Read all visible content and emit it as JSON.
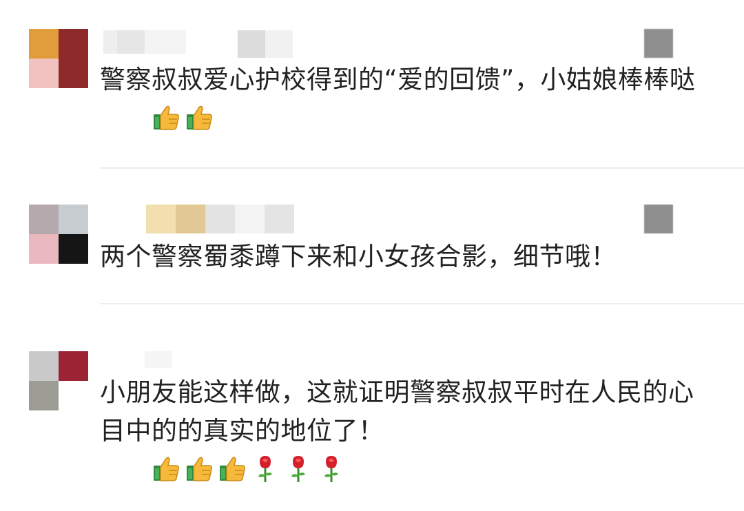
{
  "comments": [
    {
      "text": "警察叔叔爱心护校得到的“爱的回馈”，小姑娘棒棒哒",
      "emojis": [
        "thumbs-up-icon",
        "thumbs-up-icon"
      ]
    },
    {
      "text": "两个警察蜀黍蹲下来和小女孩合影，细节哦！",
      "emojis": []
    },
    {
      "text": "小朋友能这样做，这就证明警察叔叔平时在人民的心目中的的真实的地位了！",
      "emojis": [
        "thumbs-up-icon",
        "thumbs-up-icon",
        "thumbs-up-icon",
        "rose-icon",
        "rose-icon",
        "rose-icon"
      ]
    }
  ],
  "colors": {
    "text": "#222222",
    "divider": "#ececec",
    "background": "#ffffff"
  }
}
